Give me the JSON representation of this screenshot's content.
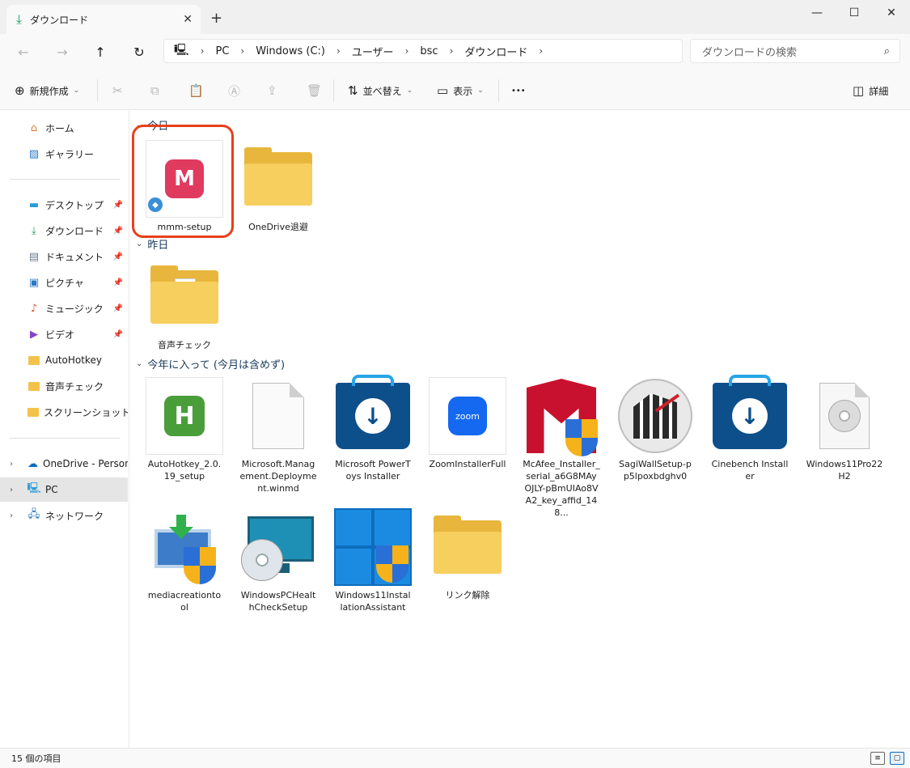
{
  "window": {
    "tab_title": "ダウンロード",
    "tab_close": "✕",
    "new_tab": "+",
    "minimize": "—",
    "maximize": "☐",
    "close": "✕"
  },
  "nav": {
    "back": "←",
    "forward": "→",
    "up": "↑",
    "refresh": "↻",
    "breadcrumb": [
      "PC",
      "Windows (C:)",
      "ユーザー",
      "bsc",
      "ダウンロード"
    ],
    "search_placeholder": "ダウンロードの検索"
  },
  "commands": {
    "new": "新規作成",
    "sort": "並べ替え",
    "view": "表示",
    "more": "•••",
    "details": "詳細"
  },
  "sidebar": {
    "items": [
      {
        "label": "ホーム",
        "icon": "home-icon",
        "pinned": false
      },
      {
        "label": "ギャラリー",
        "icon": "gallery-icon",
        "pinned": false
      },
      {
        "label": "デスクトップ",
        "icon": "desktop-icon",
        "pinned": true
      },
      {
        "label": "ダウンロード",
        "icon": "download-icon",
        "pinned": true
      },
      {
        "label": "ドキュメント",
        "icon": "document-icon",
        "pinned": true
      },
      {
        "label": "ピクチャ",
        "icon": "picture-icon",
        "pinned": true
      },
      {
        "label": "ミュージック",
        "icon": "music-icon",
        "pinned": true
      },
      {
        "label": "ビデオ",
        "icon": "video-icon",
        "pinned": true
      },
      {
        "label": "AutoHotkey",
        "icon": "folder-icon",
        "pinned": false
      },
      {
        "label": "音声チェック",
        "icon": "folder-icon",
        "pinned": false
      },
      {
        "label": "スクリーンショット",
        "icon": "folder-icon",
        "pinned": false
      },
      {
        "label": "OneDrive - Persona",
        "icon": "onedrive-icon",
        "pinned": false
      },
      {
        "label": "PC",
        "icon": "pc-icon",
        "pinned": false
      },
      {
        "label": "ネットワーク",
        "icon": "network-icon",
        "pinned": false
      }
    ]
  },
  "groups": {
    "today": "今日",
    "yesterday": "昨日",
    "this_year": "今年に入って (今月は含めず)"
  },
  "files": {
    "today": [
      "mmm-setup",
      "OneDrive退避"
    ],
    "yesterday": [
      "音声チェック"
    ],
    "this_year": [
      "AutoHotkey_2.0.19_setup",
      "Microsoft.Management.Deployment.winmd",
      "Microsoft PowerToys Installer",
      "ZoomInstallerFull",
      "McAfee_Installer_serial_a6G8MAyOJLY-pBmUIAo8VA2_key_affid_148...",
      "SagiWallSetup-pp5lpoxbdghv0",
      "Cinebench Installer",
      "Windows11Pro22H2",
      "mediacreationtool",
      "WindowsPCHealthCheckSetup",
      "Windows11InstallationAssistant",
      "リンク解除"
    ]
  },
  "icon_text": {
    "mm_letter": "M",
    "ahk_letter": "H",
    "zoom": "zoom"
  },
  "status": {
    "count": "15 個の項目"
  },
  "colors": {
    "highlight": "#e7401a",
    "accent": "#0f6cbd"
  }
}
